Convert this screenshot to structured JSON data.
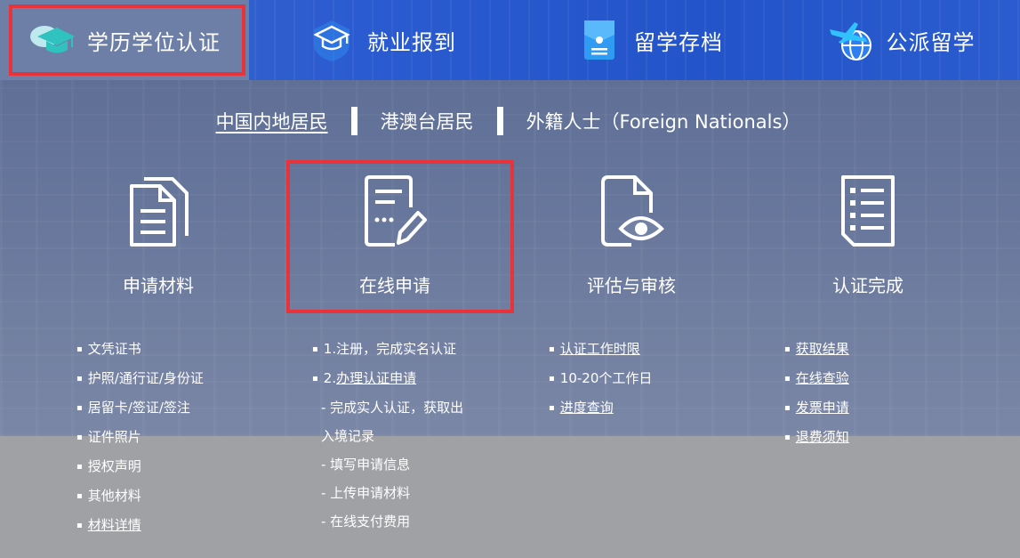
{
  "nav": [
    {
      "label": "学历学位认证",
      "icon": "graduation-cap-icon",
      "active": true
    },
    {
      "label": "就业报到",
      "icon": "grad-shield-icon",
      "active": false
    },
    {
      "label": "留学存档",
      "icon": "folder-archive-icon",
      "active": false
    },
    {
      "label": "公派留学",
      "icon": "plane-globe-icon",
      "active": false
    }
  ],
  "tabs": [
    {
      "label": "中国内地居民",
      "active": true
    },
    {
      "label": "港澳台居民",
      "active": false
    },
    {
      "label": "外籍人士（Foreign Nationals）",
      "active": false
    }
  ],
  "steps": [
    {
      "label": "申请材料",
      "icon": "documents-icon"
    },
    {
      "label": "在线申请",
      "icon": "edit-form-icon"
    },
    {
      "label": "评估与审核",
      "icon": "doc-eye-icon"
    },
    {
      "label": "认证完成",
      "icon": "checklist-icon"
    }
  ],
  "col1": [
    "文凭证书",
    "护照/通行证/身份证",
    "居留卡/签证/签注",
    "证件照片",
    "授权声明",
    "其他材料",
    "材料详情"
  ],
  "col2": {
    "item1": "1.注册，完成实名认证",
    "item2_prefix": "2.",
    "item2_link": "办理认证申请",
    "sub": [
      "- 完成实人认证，获取出",
      "入境记录",
      "- 填写申请信息",
      "- 上传申请材料",
      "- 在线支付费用"
    ]
  },
  "col3": [
    "认证工作时限",
    "10-20个工作日",
    "进度查询"
  ],
  "col4": [
    "获取结果",
    "在线查验",
    "发票申请",
    "退费须知"
  ],
  "colors": {
    "highlight": "#e8333a",
    "topbar": "#2a5bd0",
    "accent_teal": "#3fd0c9"
  }
}
